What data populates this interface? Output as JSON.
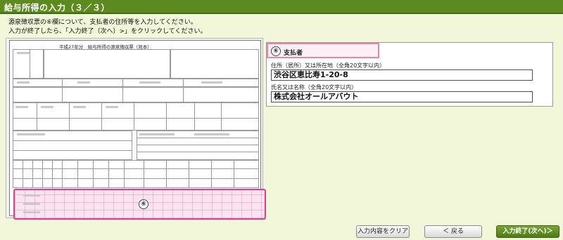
{
  "header": {
    "title": "給与所得の入力（３／３）"
  },
  "instructions": {
    "line1": "源泉徴収票の⑥欄について、支払者の住所等を入力してください。",
    "line2": "入力が終了したら、「入力終了（次へ）>」をクリックしてください。"
  },
  "document": {
    "title": "平成27年分　給与所得の源泉徴収票（見本）",
    "marker": "⑥"
  },
  "form": {
    "section_marker": "⑥",
    "section_label": "支払者",
    "address_label": "住所（居所）又は所在地（全角20文字以内）",
    "address_value": "渋谷区恵比寿1-20-8",
    "name_label": "氏名又は名称（全角20文字以内）",
    "name_value": "株式会社オールアバウト"
  },
  "buttons": {
    "clear": "入力内容をクリア",
    "back": "＜ 戻る",
    "next": "入力終了(次へ)＞"
  },
  "colors": {
    "header_bg": "#5c8a1e",
    "page_bg": "#f2f7d9",
    "highlight": "#e43b8a"
  }
}
